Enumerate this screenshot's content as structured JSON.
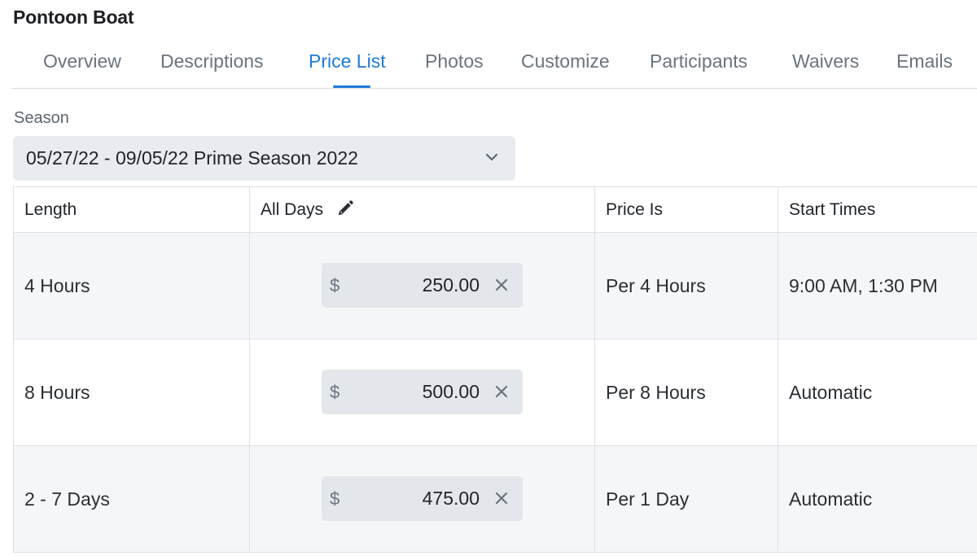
{
  "page": {
    "title": "Pontoon Boat"
  },
  "tabs": [
    {
      "label": "Overview",
      "active": false
    },
    {
      "label": "Descriptions",
      "active": false
    },
    {
      "label": "Price List",
      "active": true
    },
    {
      "label": "Photos",
      "active": false
    },
    {
      "label": "Customize",
      "active": false
    },
    {
      "label": "Participants",
      "active": false
    },
    {
      "label": "Waivers",
      "active": false
    },
    {
      "label": "Emails",
      "active": false
    }
  ],
  "season": {
    "label": "Season",
    "value": "05/27/22 - 09/05/22 Prime Season 2022",
    "icon": "chevron-down-icon"
  },
  "table": {
    "headers": {
      "length": "Length",
      "all_days": "All Days",
      "price_is": "Price Is",
      "start_times": "Start Times"
    },
    "rows": [
      {
        "length": "4 Hours",
        "currency": "$",
        "price": "250.00",
        "price_is": "Per 4 Hours",
        "start_times": "9:00 AM, 1:30 PM"
      },
      {
        "length": "8 Hours",
        "currency": "$",
        "price": "500.00",
        "price_is": "Per 8 Hours",
        "start_times": "Automatic"
      },
      {
        "length": "2 - 7 Days",
        "currency": "$",
        "price": "475.00",
        "price_is": "Per 1 Day",
        "start_times": "Automatic"
      }
    ]
  },
  "colors": {
    "accent": "#1f7ad4",
    "tab_inactive": "#6b737d",
    "field_bg": "#e3e6ea",
    "row_shaded": "#f5f6f8"
  }
}
